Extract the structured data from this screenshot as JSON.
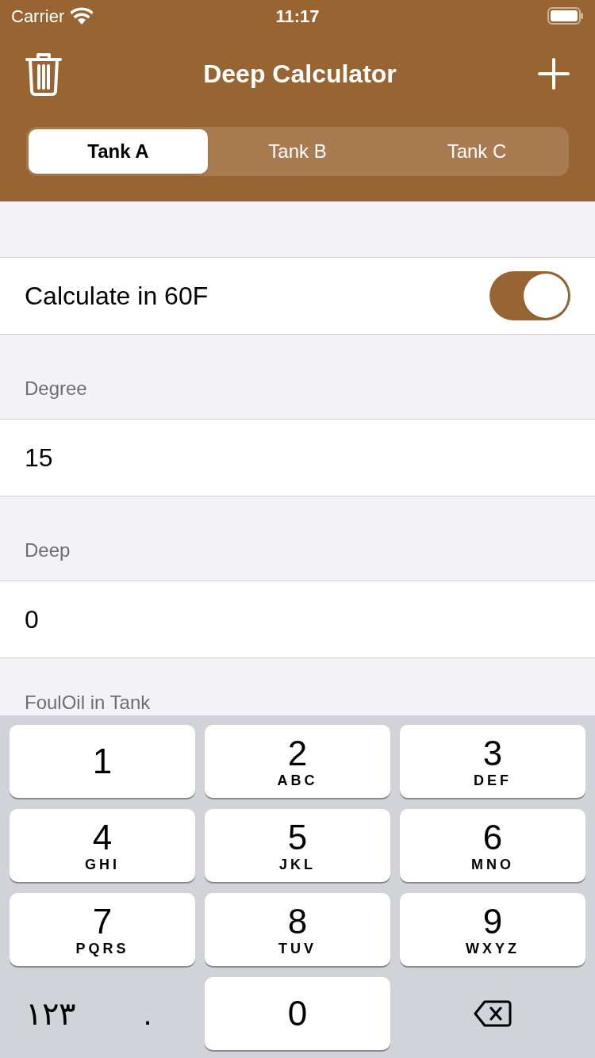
{
  "status_bar": {
    "carrier": "Carrier",
    "time": "11:17"
  },
  "nav": {
    "title": "Deep Calculator"
  },
  "tabs": [
    {
      "label": "Tank A",
      "selected": true
    },
    {
      "label": "Tank B",
      "selected": false
    },
    {
      "label": "Tank C",
      "selected": false
    }
  ],
  "toggle_row": {
    "label": "Calculate in 60F",
    "on": true
  },
  "fields": [
    {
      "header": "Degree",
      "value": "15"
    },
    {
      "header": "Deep",
      "value": "0"
    }
  ],
  "next_header": "FoulOil in Tank",
  "keyboard": [
    {
      "kind": "digit",
      "digit": "1"
    },
    {
      "kind": "digit",
      "digit": "2",
      "letters": "ABC"
    },
    {
      "kind": "digit",
      "digit": "3",
      "letters": "DEF"
    },
    {
      "kind": "digit",
      "digit": "4",
      "letters": "GHI"
    },
    {
      "kind": "digit",
      "digit": "5",
      "letters": "JKL"
    },
    {
      "kind": "digit",
      "digit": "6",
      "letters": "MNO"
    },
    {
      "kind": "digit",
      "digit": "7",
      "letters": "PQRS"
    },
    {
      "kind": "digit",
      "digit": "8",
      "letters": "TUV"
    },
    {
      "kind": "digit",
      "digit": "9",
      "letters": "WXYZ"
    },
    {
      "kind": "plain",
      "text": "١٢٣"
    },
    {
      "kind": "dot",
      "text": "."
    },
    {
      "kind": "digit",
      "digit": "0"
    },
    {
      "kind": "delete"
    }
  ]
}
